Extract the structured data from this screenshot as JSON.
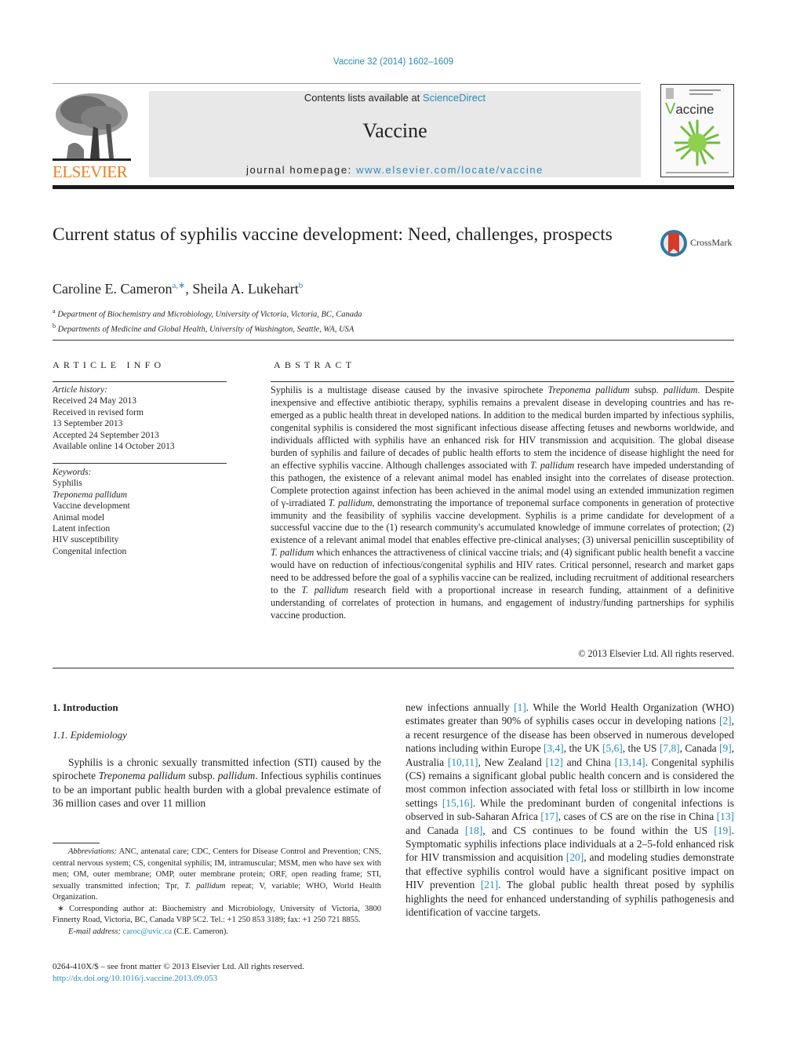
{
  "header": {
    "journal_ref": "Vaccine 32 (2014) 1602–1609",
    "contents_prefix": "Contents lists available at ",
    "contents_link": "ScienceDirect",
    "journal_name": "Vaccine",
    "homepage_prefix": "journal homepage: ",
    "homepage_link": "www.elsevier.com/locate/vaccine",
    "publisher_logo": "ELSEVIER",
    "cover_title_initial": "V",
    "cover_title_rest": "accine",
    "crossmark_label": "CrossMark"
  },
  "colors": {
    "link": "#2a8bb7",
    "elsevier_orange": "#f07f1a",
    "masthead_bg": "#e8e8e8",
    "cover_green": "#66b32e"
  },
  "article": {
    "title": "Current status of syphilis vaccine development: Need, challenges, prospects",
    "authors": [
      {
        "name": "Caroline E. Cameron",
        "sup": "a,∗"
      },
      {
        "name": "Sheila A. Lukehart",
        "sup": "b"
      }
    ],
    "author_separator": ", ",
    "affiliations": [
      {
        "mark": "a",
        "text": "Department of Biochemistry and Microbiology, University of Victoria, Victoria, BC, Canada"
      },
      {
        "mark": "b",
        "text": "Departments of Medicine and Global Health, University of Washington, Seattle, WA, USA"
      }
    ]
  },
  "article_info": {
    "heading": "ARTICLE INFO",
    "history_label": "Article history:",
    "history": [
      "Received 24 May 2013",
      "Received in revised form",
      "13 September 2013",
      "Accepted 24 September 2013",
      "Available online 14 October 2013"
    ],
    "keywords_label": "Keywords:",
    "keywords": [
      {
        "text": "Syphilis",
        "italic": false
      },
      {
        "text": "Treponema pallidum",
        "italic": true
      },
      {
        "text": "Vaccine development",
        "italic": false
      },
      {
        "text": "Animal model",
        "italic": false
      },
      {
        "text": "Latent infection",
        "italic": false
      },
      {
        "text": "HIV susceptibility",
        "italic": false
      },
      {
        "text": "Congenital infection",
        "italic": false
      }
    ]
  },
  "abstract": {
    "heading": "ABSTRACT",
    "segments": [
      {
        "t": "Syphilis is a multistage disease caused by the invasive spirochete "
      },
      {
        "t": "Treponema pallidum",
        "i": true
      },
      {
        "t": " subsp. "
      },
      {
        "t": "pallidum",
        "i": true
      },
      {
        "t": ". Despite inexpensive and effective antibiotic therapy, syphilis remains a prevalent disease in develop­ing countries and has re-emerged as a public health threat in developed nations. In addition to the medical burden imparted by infectious syphilis, congenital syphilis is considered the most significant infectious disease affecting fetuses and newborns worldwide, and individuals afflicted with syphilis have an enhanced risk for HIV transmission and acquisition. The global disease burden of syphilis and failure of decades of public health efforts to stem the incidence of disease highlight the need for an effective syphilis vaccine. Although challenges associated with "
      },
      {
        "t": "T. pallidum",
        "i": true
      },
      {
        "t": " research have impeded understanding of this pathogen, the existence of a relevant animal model has enabled insight into the correlates of disease pro­tection. Complete protection against infection has been achieved in the animal model using an extended immunization regimen of γ-irradiated "
      },
      {
        "t": "T. pallidum",
        "i": true
      },
      {
        "t": ", demonstrating the importance of treponemal surface components in generation of protective immunity and the feasibility of syphilis vaccine development. Syphilis is a prime candidate for development of a successful vaccine due to the (1) research community's accumulated knowledge of immune correlates of protection; (2) existence of a relevant animal model that enables effective pre-clinical analyses; (3) universal penicillin susceptibility of "
      },
      {
        "t": "T. pallidum",
        "i": true
      },
      {
        "t": " which enhances the attractiveness of clinical vaccine trials; and (4) significant public health benefit a vaccine would have on reduction of infectious/congenital syphilis and HIV rates. Critical personnel, research and market gaps need to be addressed before the goal of a syphilis vaccine can be realized, including recruit­ment of additional researchers to the "
      },
      {
        "t": "T. pallidum",
        "i": true
      },
      {
        "t": " research field with a proportional increase in research funding, attainment of a definitive understanding of correlates of protection in humans, and engagement of industry/funding partnerships for syphilis vaccine production."
      }
    ],
    "copyright": "© 2013 Elsevier Ltd. All rights reserved."
  },
  "body": {
    "section_heading": "1.  Introduction",
    "subsection_heading": "1.1.  Epidemiology",
    "col1_segments": [
      {
        "t": "Syphilis is a chronic sexually transmitted infection (STI) caused by the spirochete "
      },
      {
        "t": "Treponema pallidum",
        "i": true
      },
      {
        "t": " subsp. "
      },
      {
        "t": "pallidum",
        "i": true
      },
      {
        "t": ". Infectious syphilis continues to be an important public health burden with a global prevalence estimate of 36 million cases and over 11 million"
      }
    ],
    "col2_segments": [
      {
        "t": "new infections annually "
      },
      {
        "t": "[1]",
        "l": true
      },
      {
        "t": ". While the World Health Organiza­tion (WHO) estimates greater than 90% of syphilis cases occur in developing nations "
      },
      {
        "t": "[2]",
        "l": true
      },
      {
        "t": ", a recent resurgence of the disease has been observed in numerous developed nations including within Europe "
      },
      {
        "t": "[3,4]",
        "l": true
      },
      {
        "t": ", the UK "
      },
      {
        "t": "[5,6]",
        "l": true
      },
      {
        "t": ", the US "
      },
      {
        "t": "[7,8]",
        "l": true
      },
      {
        "t": ", Canada "
      },
      {
        "t": "[9]",
        "l": true
      },
      {
        "t": ", Australia "
      },
      {
        "t": "[10,11]",
        "l": true
      },
      {
        "t": ", New Zealand "
      },
      {
        "t": "[12]",
        "l": true
      },
      {
        "t": " and China "
      },
      {
        "t": "[13,14]",
        "l": true
      },
      {
        "t": ". Congenital syphilis (CS) remains a significant global public health concern and is considered the most common infection associated with fetal loss or stillbirth in low income settings "
      },
      {
        "t": "[15,16]",
        "l": true
      },
      {
        "t": ". While the predominant burden of con­genital infections is observed in sub-Saharan Africa "
      },
      {
        "t": "[17]",
        "l": true
      },
      {
        "t": ", cases of CS are on the rise in China "
      },
      {
        "t": "[13]",
        "l": true
      },
      {
        "t": " and Canada "
      },
      {
        "t": "[18]",
        "l": true
      },
      {
        "t": ", and CS continues to be found within the US "
      },
      {
        "t": "[19]",
        "l": true
      },
      {
        "t": ". Symptomatic syphilis infections place individuals at a 2–5-fold enhanced risk for HIV transmis­sion and acquisition "
      },
      {
        "t": "[20]",
        "l": true
      },
      {
        "t": ", and modeling studies demonstrate that effective syphilis control would have a significant positive impact on HIV prevention "
      },
      {
        "t": "[21]",
        "l": true
      },
      {
        "t": ". The global public health threat posed by syphilis highlights the need for enhanced understanding of syphilis pathogenesis and identification of vaccine targets."
      }
    ]
  },
  "footnotes": {
    "abbrev_label": "Abbreviations:",
    "abbrev_segments": [
      {
        "t": " ANC, antenatal care; CDC, Centers for Disease Control and Preven­tion; CNS, central nervous system; CS, congenital syphilis; IM, intramuscular; MSM, men who have sex with men; OM, outer membrane; OMP, outer membrane pro­tein; ORF, open reading frame; STI, sexually transmitted infection; Tpr, "
      },
      {
        "t": "T. pallidum",
        "i": true
      },
      {
        "t": " repeat; V, variable; WHO, World Health Organization."
      }
    ],
    "corresponding": "∗ Corresponding author at: Biochemistry and Microbiology, University of Victoria, 3800 Finnerty Road, Victoria, BC, Canada V8P 5C2. Tel.: +1 250 853 3189; fax: +1 250 721 8855.",
    "email_label": "E-mail address:",
    "email": "caroc@uvic.ca",
    "email_suffix": " (C.E. Cameron)."
  },
  "front_matter": {
    "issn_line": "0264-410X/$ – see front matter © 2013 Elsevier Ltd. All rights reserved.",
    "doi": "http://dx.doi.org/10.1016/j.vaccine.2013.09.053"
  }
}
